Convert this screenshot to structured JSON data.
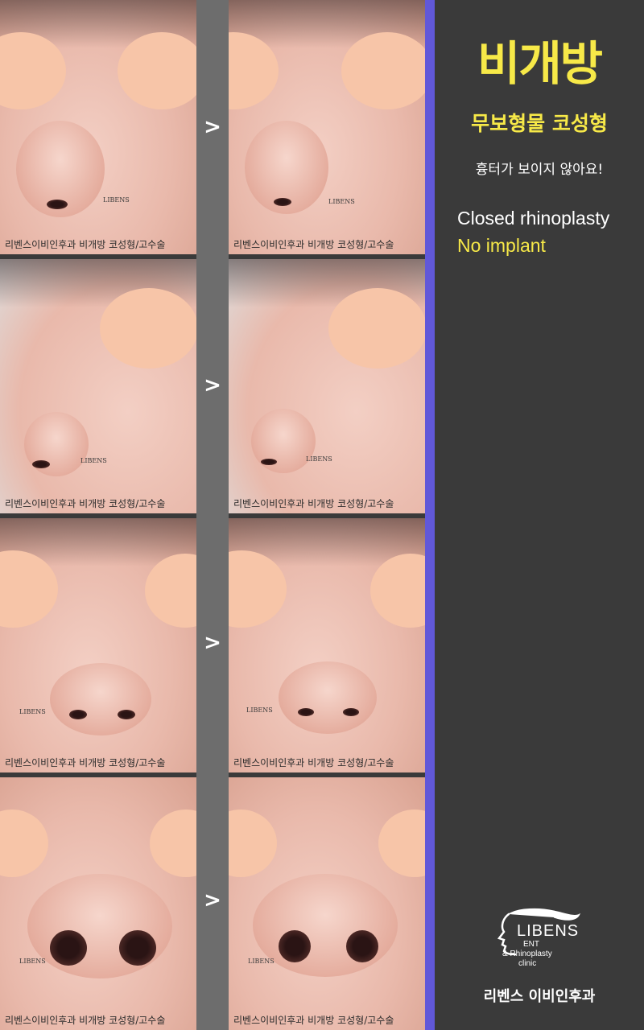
{
  "title": "비개방",
  "subtitle": "무보형물 코성형",
  "tagline": "흉터가 보이지 않아요!",
  "english": {
    "line1": "Closed rhinoplasty",
    "line2": "No implant"
  },
  "arrow_symbol": ">",
  "photo_watermark": "리벤스이비인후과  비개방 코성형/고수술",
  "photo_stamp": "LIBENS",
  "photo_rows": [
    {
      "view": "left-oblique"
    },
    {
      "view": "left-profile"
    },
    {
      "view": "frontal"
    },
    {
      "view": "basal"
    }
  ],
  "logo": {
    "name": "LIBENS",
    "line1": "ENT",
    "line2": "& Rhinoplasty",
    "line3": "clinic"
  },
  "clinic_name": "리벤스 이비인후과",
  "colors": {
    "accent_yellow": "#f7e948",
    "accent_bar": "#6158d8",
    "panel_bg": "#3a3a3a",
    "divider": "#6d6d6d",
    "face_mask": "#f7c5a8"
  }
}
